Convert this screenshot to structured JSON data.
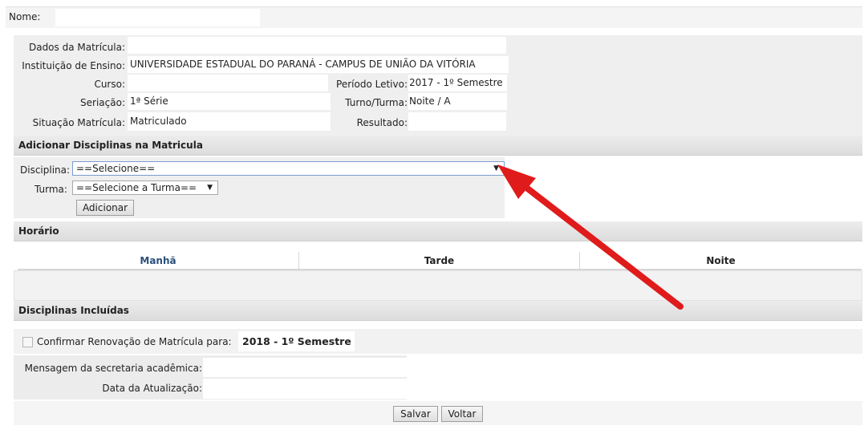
{
  "top": {
    "nome_label": "Nome:"
  },
  "matricula": {
    "dados_label": "Dados da Matrícula:",
    "instituicao_label": "Instituição de Ensino:",
    "instituicao_value": "UNIVERSIDADE ESTADUAL DO PARANÁ - CAMPUS DE UNIÃO DA VITÓRIA",
    "curso_label": "Curso:",
    "periodo_label": "Período Letivo:",
    "periodo_value": "2017 - 1º Semestre",
    "seriacao_label": "Seriação:",
    "seriacao_value": "1ª Série",
    "turno_label": "Turno/Turma:",
    "turno_value": "Noite / A",
    "situacao_label": "Situação Matrícula:",
    "situacao_value": "Matriculado",
    "resultado_label": "Resultado:"
  },
  "adicionar": {
    "header": "Adicionar Disciplinas na Matricula",
    "disciplina_label": "Disciplina:",
    "disciplina_value": "==Selecione==",
    "turma_label": "Turma:",
    "turma_value": "==Selecione a Turma==",
    "add_button": "Adicionar"
  },
  "horario": {
    "header": "Horário",
    "tabs": [
      "Manhã",
      "Tarde",
      "Noite"
    ]
  },
  "incluidas": {
    "header": "Disciplinas Incluídas"
  },
  "renovacao": {
    "label": "Confirmar Renovação de Matrícula para:",
    "value": "2018 - 1º Semestre"
  },
  "rodape": {
    "mensagem_label": "Mensagem da secretaria acadêmica:",
    "data_label": "Data da Atualização:",
    "salvar": "Salvar",
    "voltar": "Voltar"
  },
  "colors": {
    "accent_arrow": "#e01b1b",
    "active_tab_text": "#2a4f7c",
    "header_bg": "#dcdcdc"
  },
  "icons": {
    "dropdown": "triangle-down",
    "checkbox": "unchecked-box"
  }
}
